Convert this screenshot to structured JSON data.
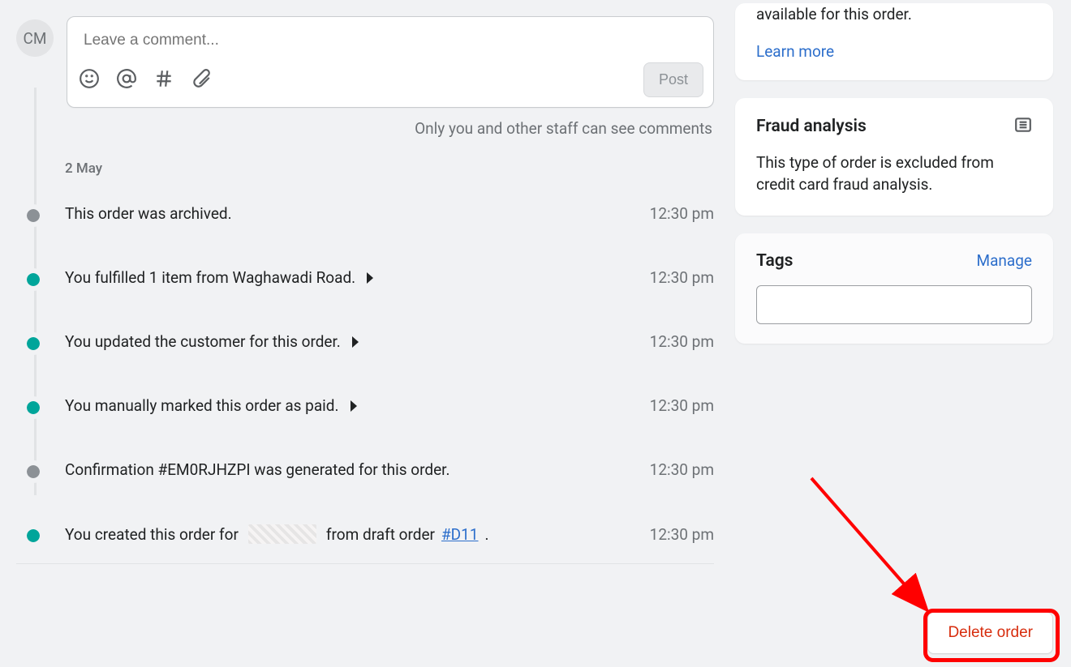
{
  "avatar_initials": "CM",
  "comment": {
    "placeholder": "Leave a comment...",
    "post_label": "Post",
    "staff_note": "Only you and other staff can see comments"
  },
  "timeline": {
    "date": "2 May",
    "events": [
      {
        "text": "This order was archived.",
        "time": "12:30 pm",
        "dot": "grey",
        "expandable": false
      },
      {
        "text": "You fulfilled 1 item from Waghawadi Road.",
        "time": "12:30 pm",
        "dot": "teal",
        "expandable": true
      },
      {
        "text": "You updated the customer for this order.",
        "time": "12:30 pm",
        "dot": "teal",
        "expandable": true
      },
      {
        "text": "You manually marked this order as paid.",
        "time": "12:30 pm",
        "dot": "teal",
        "expandable": true
      },
      {
        "text": "Confirmation #EM0RJHZPI was generated for this order.",
        "time": "12:30 pm",
        "dot": "grey",
        "expandable": false
      }
    ],
    "created": {
      "prefix": "You created this order for",
      "suffix": "from draft order ",
      "link_text": "#D11",
      "time": "12:30 pm",
      "dot": "teal"
    }
  },
  "sidebar": {
    "conversion": {
      "text": "available for this order.",
      "learn_more": "Learn more"
    },
    "fraud": {
      "title": "Fraud analysis",
      "text": "This type of order is excluded from credit card fraud analysis."
    },
    "tags": {
      "title": "Tags",
      "manage": "Manage"
    }
  },
  "delete_label": "Delete order"
}
